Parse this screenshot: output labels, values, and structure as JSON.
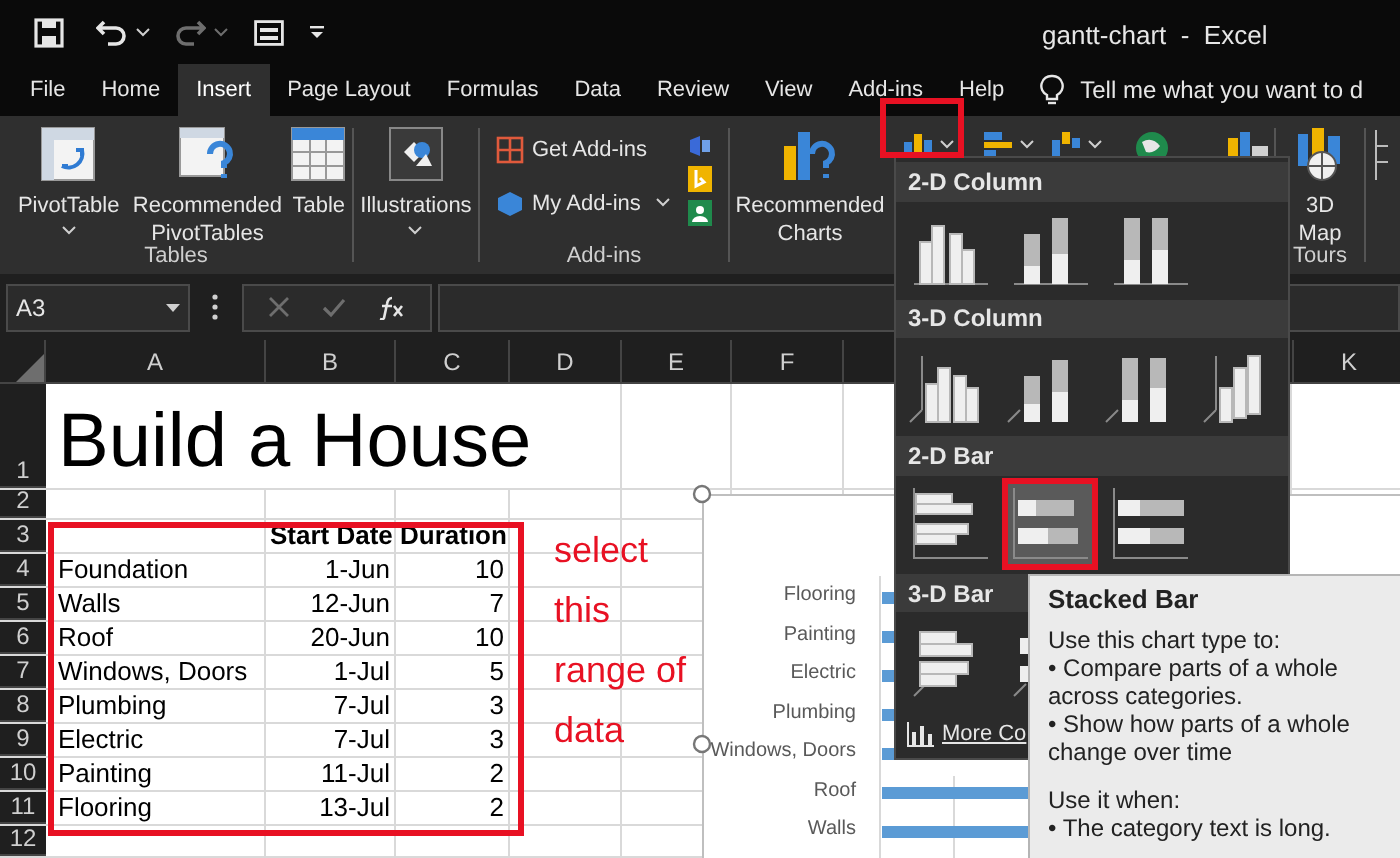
{
  "window": {
    "title": "gantt-chart  -  Excel"
  },
  "tabs": [
    {
      "label": "File",
      "selected": false
    },
    {
      "label": "Home",
      "selected": false
    },
    {
      "label": "Insert",
      "selected": true
    },
    {
      "label": "Page Layout",
      "selected": false
    },
    {
      "label": "Formulas",
      "selected": false
    },
    {
      "label": "Data",
      "selected": false
    },
    {
      "label": "Review",
      "selected": false
    },
    {
      "label": "View",
      "selected": false
    },
    {
      "label": "Add-ins",
      "selected": false
    },
    {
      "label": "Help",
      "selected": false
    }
  ],
  "tell_me": {
    "placeholder": "Tell me what you want to d"
  },
  "ribbon": {
    "tables": {
      "label": "Tables",
      "buttons": [
        "PivotTable",
        "Recommended PivotTables",
        "Table"
      ]
    },
    "illustrations": {
      "button": "Illustrations"
    },
    "add_ins": {
      "label": "Add-ins",
      "buttons": [
        "Get Add-ins",
        "My Add-ins"
      ]
    },
    "charts": {
      "button": "Recommended Charts"
    },
    "tours": {
      "label": "Tours",
      "button": "3D Map"
    }
  },
  "formula_bar": {
    "name_box": "A3"
  },
  "sheet": {
    "columns": [
      "A",
      "B",
      "C",
      "D",
      "E",
      "F"
    ],
    "columns_right": [
      "K"
    ],
    "rows": [
      "1",
      "2",
      "3",
      "4",
      "5",
      "6",
      "7",
      "8",
      "9",
      "10",
      "11",
      "12"
    ],
    "title": "Build a House",
    "table_header": [
      "Start Date",
      "Duration"
    ],
    "table_rows": [
      [
        "Foundation",
        "1-Jun",
        "10"
      ],
      [
        "Walls",
        "12-Jun",
        "7"
      ],
      [
        "Roof",
        "20-Jun",
        "10"
      ],
      [
        "Windows, Doors",
        "1-Jul",
        "5"
      ],
      [
        "Plumbing",
        "7-Jul",
        "3"
      ],
      [
        "Electric",
        "7-Jul",
        "3"
      ],
      [
        "Painting",
        "11-Jul",
        "2"
      ],
      [
        "Flooring",
        "13-Jul",
        "2"
      ]
    ]
  },
  "note": "select this range of data",
  "chart": {
    "categories": [
      "Flooring",
      "Painting",
      "Electric",
      "Plumbing",
      "Windows, Doors",
      "Roof",
      "Walls"
    ]
  },
  "chart_gallery": {
    "sections": [
      {
        "title": "2-D Column",
        "items": [
          {
            "kind": "clustered-column",
            "selected": false
          },
          {
            "kind": "stacked-column",
            "selected": false
          },
          {
            "kind": "full-stacked-column",
            "selected": false
          }
        ]
      },
      {
        "title": "3-D Column",
        "items": [
          {
            "kind": "clustered-column-3d",
            "selected": false
          },
          {
            "kind": "stacked-column-3d",
            "selected": false
          },
          {
            "kind": "full-stacked-column-3d",
            "selected": false
          },
          {
            "kind": "column-3d",
            "selected": false
          }
        ]
      },
      {
        "title": "2-D Bar",
        "items": [
          {
            "kind": "clustered-bar",
            "selected": false
          },
          {
            "kind": "stacked-bar",
            "selected": true
          },
          {
            "kind": "full-stacked-bar",
            "selected": false
          }
        ]
      },
      {
        "title": "3-D Bar",
        "items": [
          {
            "kind": "clustered-bar-3d",
            "selected": false
          },
          {
            "kind": "stacked-bar-3d",
            "selected": false
          }
        ]
      }
    ],
    "more": "More Co"
  },
  "tooltip": {
    "title": "Stacked Bar",
    "sections": [
      {
        "heading": "Use this chart type to:",
        "bullets": [
          "• Compare parts of a whole across categories.",
          "• Show how parts of a whole change over time"
        ]
      },
      {
        "heading": "Use it when:",
        "bullets": [
          "• The category text is long."
        ]
      }
    ]
  }
}
